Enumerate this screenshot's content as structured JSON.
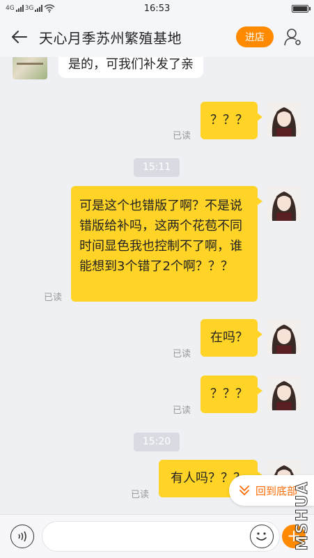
{
  "status_bar": {
    "signal_1": "4G",
    "signal_2": "3G",
    "time": "16:53"
  },
  "header": {
    "title": "天心月季苏州繁殖基地",
    "shop_button": "进店"
  },
  "messages": [
    {
      "side": "left",
      "text": "是的，可我们补发了亲"
    },
    {
      "side": "right",
      "text": "？？？",
      "read": "已读"
    },
    {
      "type": "time",
      "text": "15:11"
    },
    {
      "side": "right",
      "text": "可是这个也错版了啊？不是说错版给补吗，这两个花苞不同时间显色我也控制不了啊，谁能想到3个错了2个啊？？？",
      "read": "已读"
    },
    {
      "side": "right",
      "text": "在吗？",
      "read": "已读"
    },
    {
      "side": "right",
      "text": "？？？",
      "read": "已读"
    },
    {
      "type": "time",
      "text": "15:20"
    },
    {
      "side": "right",
      "text": "有人吗？？？",
      "read": "已读"
    }
  ],
  "scroll_to_bottom": "回到底部",
  "input": {
    "placeholder": ""
  },
  "watermark": "MSHUA"
}
